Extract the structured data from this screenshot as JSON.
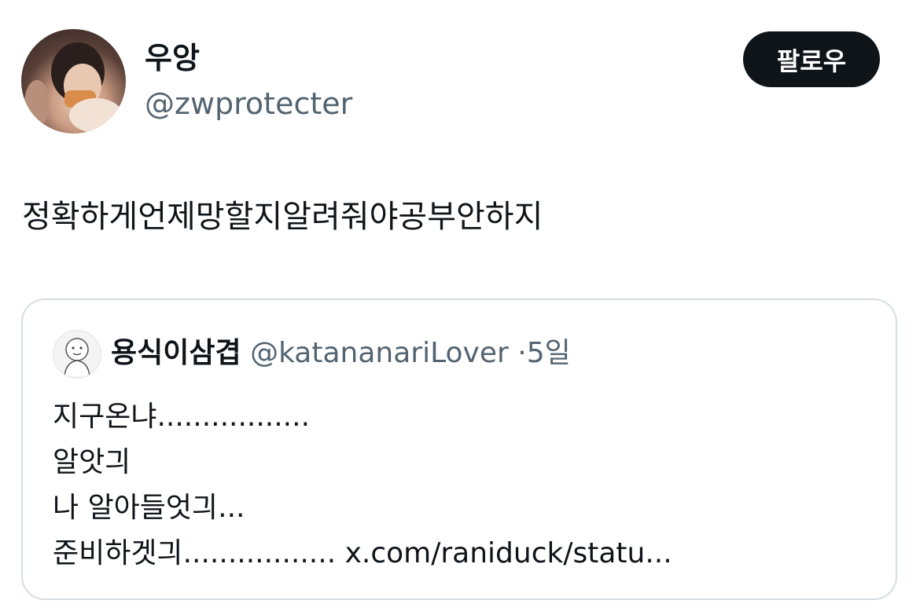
{
  "author": {
    "display_name": "우앙",
    "handle": "@zwprotecter",
    "follow_label": "팔로우"
  },
  "tweet": {
    "text": "정확하게언제망할지알려줘야공부안하지"
  },
  "quote": {
    "display_name": "용식이삼겹",
    "handle": "@katananariLover",
    "separator": "·",
    "time": "5일",
    "lines": [
      "지구온냐.................",
      "알앗긔",
      "나 알아들엇긔...",
      "준비하겟긔................."
    ],
    "link": "x.com/raniduck/statu..."
  },
  "colors": {
    "text_primary": "#0f1419",
    "text_secondary": "#536471",
    "border": "#d6dde3",
    "button_bg": "#0f1419",
    "button_text": "#ffffff"
  }
}
